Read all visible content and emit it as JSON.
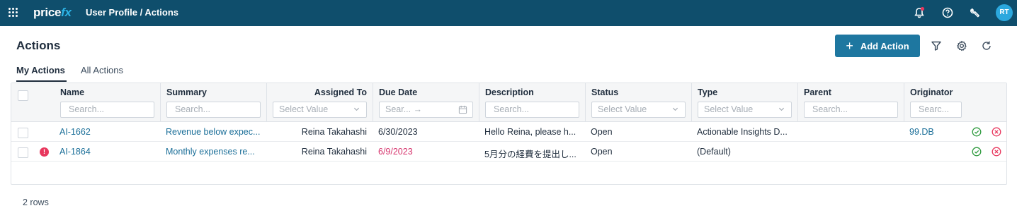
{
  "topbar": {
    "logo_main": "price",
    "logo_accent": "fx",
    "breadcrumb": "User Profile / Actions",
    "avatar_initials": "RT",
    "icons": [
      "apps-grid-icon",
      "notification-bell-icon",
      "help-icon",
      "tools-icon"
    ],
    "notification_dot_color": "#e8385e"
  },
  "page": {
    "title": "Actions",
    "add_button_label": "Add Action",
    "toolbar_icons": [
      "filter-icon",
      "settings-icon",
      "refresh-icon"
    ]
  },
  "tabs": [
    {
      "label": "My Actions",
      "active": true
    },
    {
      "label": "All Actions",
      "active": false
    }
  ],
  "columns": [
    {
      "label": "Name",
      "filter": "Search..."
    },
    {
      "label": "Summary",
      "filter": "Search..."
    },
    {
      "label": "Assigned To",
      "filter": "Select Value"
    },
    {
      "label": "Due Date",
      "filter": "Sear... →"
    },
    {
      "label": "Description",
      "filter": "Search..."
    },
    {
      "label": "Status",
      "filter": "Select Value"
    },
    {
      "label": "Type",
      "filter": "Select Value"
    },
    {
      "label": "Parent",
      "filter": "Search..."
    },
    {
      "label": "Originator",
      "filter": "Searc..."
    }
  ],
  "rows": [
    {
      "name": "AI-1662",
      "summary": "Revenue below expec...",
      "assigned_to": "Reina Takahashi",
      "due_date": "6/30/2023",
      "description": "Hello Reina, please h...",
      "status": "Open",
      "type": "Actionable Insights D...",
      "parent": "",
      "originator": "99.DB",
      "overdue": false
    },
    {
      "name": "AI-1864",
      "summary": "Monthly expenses re...",
      "assigned_to": "Reina Takahashi",
      "due_date": "6/9/2023",
      "description": "5月分の経費を提出し...",
      "status": "Open",
      "type": "(Default)",
      "parent": "",
      "originator": "",
      "overdue": true
    }
  ],
  "footer": {
    "row_count": "2 rows"
  },
  "colors": {
    "topbar": "#0f4e6c",
    "primary": "#1e77a0",
    "link": "#1a6e98",
    "overdue": "#d6336c",
    "approve": "#2e9a3e",
    "reject": "#e8385e"
  }
}
